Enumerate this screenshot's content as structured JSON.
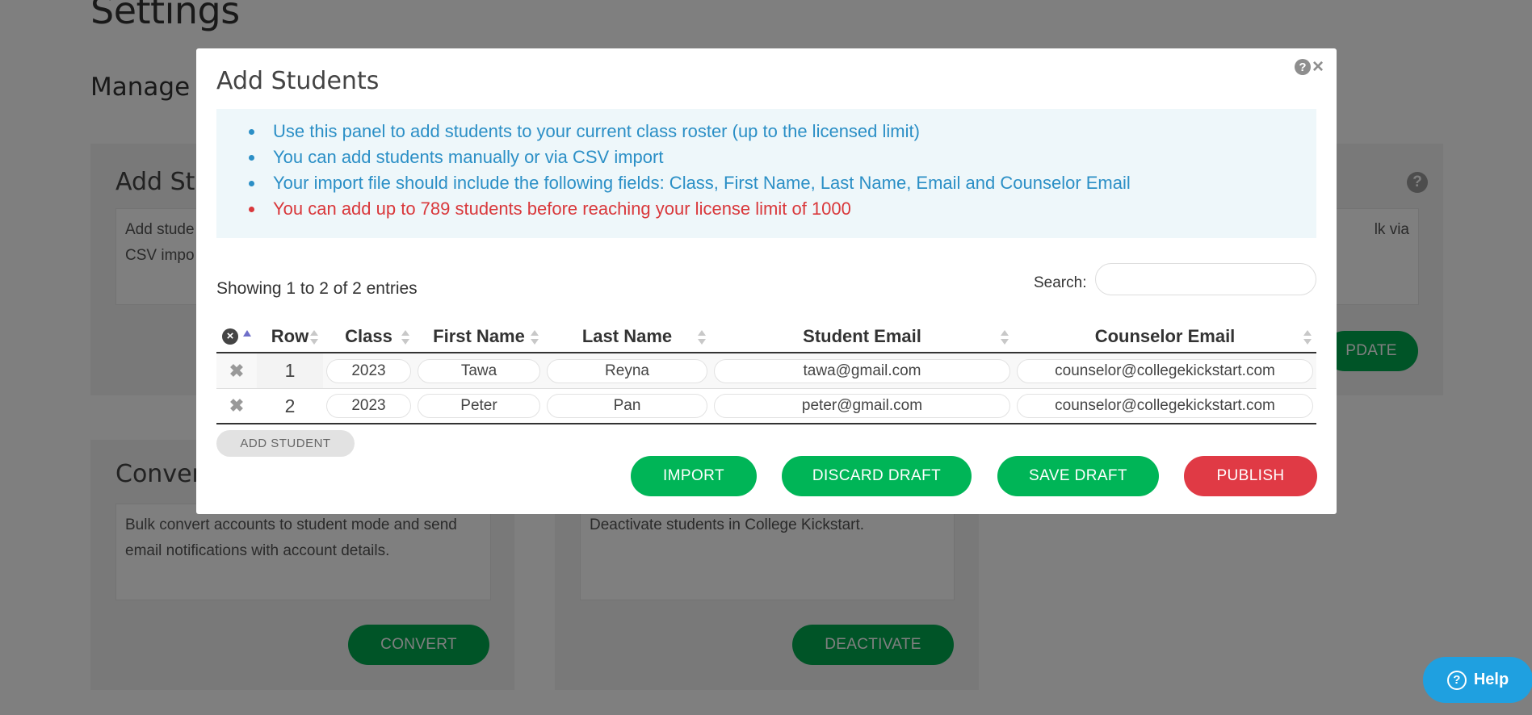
{
  "page": {
    "title": "Settings",
    "section_title": "Manage S"
  },
  "background": {
    "card_add": {
      "heading": "Add Stu",
      "desc": "Add stude\nCSV impo"
    },
    "card_update": {
      "desc": "lk via",
      "button": "PDATE"
    },
    "card_convert": {
      "heading": "Conver",
      "desc": "Bulk convert accounts to student mode and send email notifications with account details.",
      "button": "CONVERT"
    },
    "card_deactivate": {
      "desc": "Deactivate students in College Kickstart.",
      "button": "DEACTIVATE"
    }
  },
  "help_widget": {
    "label": "Help",
    "icon": "question-circle-icon"
  },
  "modal": {
    "title": "Add Students",
    "info": [
      "Use this panel to add students to your current class roster (up to the licensed limit)",
      "You can add students manually or via CSV import",
      "Your import file should include the following fields: Class, First Name, Last Name, Email and Counselor Email"
    ],
    "warning": "You can add up to 789 students before reaching your license limit of 1000",
    "showing": "Showing 1 to 2 of 2 entries",
    "search_label": "Search:",
    "search_value": "",
    "columns": [
      "Row",
      "Class",
      "First Name",
      "Last Name",
      "Student Email",
      "Counselor Email"
    ],
    "rows": [
      {
        "row": "1",
        "class": "2023",
        "first": "Tawa",
        "last": "Reyna",
        "email": "tawa@gmail.com",
        "counselor": "counselor@collegekickstart.com"
      },
      {
        "row": "2",
        "class": "2023",
        "first": "Peter",
        "last": "Pan",
        "email": "peter@gmail.com",
        "counselor": "counselor@collegekickstart.com"
      }
    ],
    "add_student": "ADD STUDENT",
    "buttons": {
      "import": "IMPORT",
      "discard": "DISCARD DRAFT",
      "save": "SAVE DRAFT",
      "publish": "PUBLISH"
    },
    "colors": {
      "accent_green": "#00b557",
      "danger_red": "#e03a45",
      "info_blue": "#2b8fc6"
    }
  }
}
